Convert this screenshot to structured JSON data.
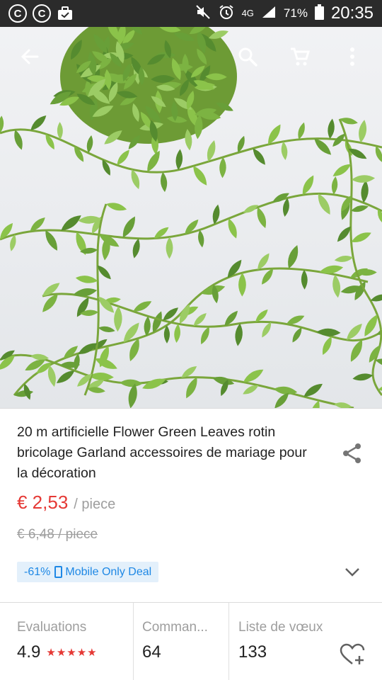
{
  "status_bar": {
    "network": "4G",
    "battery": "71%",
    "time": "20:35",
    "left_icons": [
      "copyright-circle-icon",
      "copyright-circle-icon",
      "shopping-bag-icon"
    ],
    "left_glyph": "C"
  },
  "toolbar": {
    "icons": [
      "back-arrow-icon",
      "search-icon",
      "cart-icon",
      "more-vert-icon"
    ]
  },
  "product": {
    "title": "20 m artificielle Flower Green Leaves rotin bricolage Garland accessoires de mariage pour la décoration",
    "price": "€ 2,53",
    "price_unit": "/ piece",
    "old_price": "€ 6,48 / piece",
    "deal_percent": "-61%",
    "deal_label": "Mobile Only Deal"
  },
  "stats": {
    "evaluations_label": "Evaluations",
    "evaluations_value": "4.9",
    "rating_stars": 5,
    "stars_glyph": "★★★★★",
    "orders_label": "Comman...",
    "orders_value": "64",
    "wishlist_label": "Liste de vœux",
    "wishlist_value": "133"
  },
  "colors": {
    "price": "#e53935",
    "deal_text": "#1e88e5",
    "deal_bg": "#e3f0fb",
    "status_bar": "#2b2b2b",
    "leaf_green": "#7cb342"
  }
}
